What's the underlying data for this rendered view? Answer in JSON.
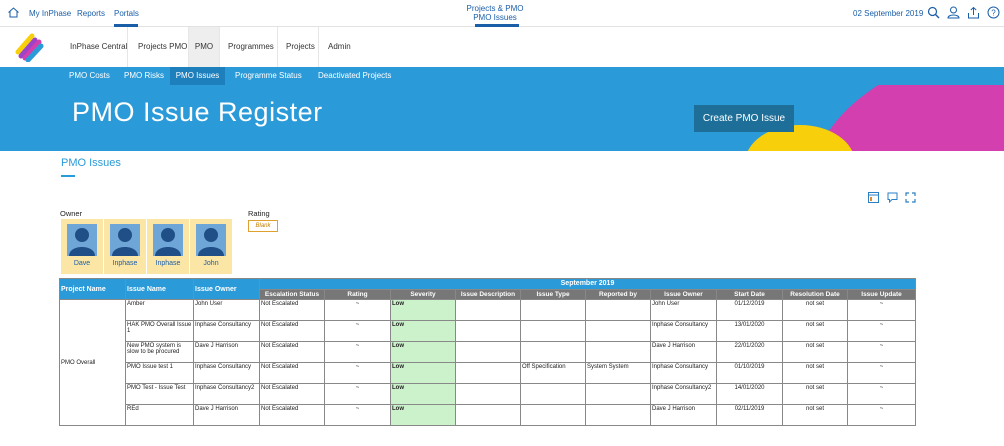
{
  "topbar": {
    "links": [
      "My InPhase",
      "Reports",
      "Portals"
    ],
    "center_line1": "Projects & PMO",
    "center_line2": "PMO Issues",
    "date": "02 September 2019",
    "icons": [
      "home-icon",
      "search-icon",
      "user-icon",
      "upload-icon",
      "help-icon"
    ]
  },
  "mainnav": {
    "items": [
      "InPhase Central",
      "Projects PMO",
      "PMO",
      "Programmes",
      "Projects",
      "Admin"
    ]
  },
  "subnav": {
    "tabs": [
      "PMO Costs",
      "PMO Risks",
      "PMO Issues",
      "Programme Status",
      "Deactivated Projects"
    ]
  },
  "banner": {
    "title": "PMO Issue Register",
    "create_button": "Create PMO Issue"
  },
  "section": {
    "title": "PMO Issues",
    "owner_label": "Owner",
    "rating_label": "Rating",
    "rating_value": "Blank"
  },
  "owners": [
    "Dave",
    "Inphase",
    "Inphase",
    "John"
  ],
  "toolbar_icons": [
    "report-icon",
    "comment-icon",
    "expand-icon"
  ],
  "table": {
    "headers": [
      "Project Name",
      "Issue Name",
      "Issue Owner"
    ],
    "month": "September 2019",
    "subheaders": [
      "Escalation Status",
      "Rating",
      "Severity",
      "Issue Description",
      "Issue Type",
      "Reported by",
      "Issue Owner",
      "Start Date",
      "Resolution Date",
      "Issue Update"
    ],
    "project": "PMO Overall",
    "rows": [
      {
        "issue": "Amber",
        "owner": "John User",
        "escalation": "Not Escalated",
        "rating": "~",
        "severity": "Low",
        "description": "",
        "type": "",
        "reported": "",
        "issue_owner": "John User",
        "start": "01/12/2019",
        "resolution": "not set",
        "update": "~"
      },
      {
        "issue": "HAK PMO Overall Issue 1",
        "owner": "Inphase Consultancy",
        "escalation": "Not Escalated",
        "rating": "~",
        "severity": "Low",
        "description": "",
        "type": "",
        "reported": "",
        "issue_owner": "Inphase Consultancy",
        "start": "13/01/2020",
        "resolution": "not set",
        "update": "~"
      },
      {
        "issue": "New PMO system is slow to be procured",
        "owner": "Dave J Harrison",
        "escalation": "Not Escalated",
        "rating": "~",
        "severity": "Low",
        "description": "",
        "type": "",
        "reported": "",
        "issue_owner": "Dave J Harrison",
        "start": "22/01/2020",
        "resolution": "not set",
        "update": "~"
      },
      {
        "issue": "PMO Issue test 1",
        "owner": "Inphase Consultancy",
        "escalation": "Not Escalated",
        "rating": "~",
        "severity": "Low",
        "description": "",
        "type": "Off Specification",
        "reported": "System System",
        "issue_owner": "Inphase Consultancy",
        "start": "01/10/2019",
        "resolution": "not set",
        "update": "~"
      },
      {
        "issue": "PMO Test - Issue Test",
        "owner": "Inphase Consultancy2",
        "escalation": "Not Escalated",
        "rating": "~",
        "severity": "Low",
        "description": "",
        "type": "",
        "reported": "",
        "issue_owner": "Inphase Consultancy2",
        "start": "14/01/2020",
        "resolution": "not set",
        "update": "~"
      },
      {
        "issue": "REd",
        "owner": "Dave J Harrison",
        "escalation": "Not Escalated",
        "rating": "~",
        "severity": "Low",
        "description": "",
        "type": "",
        "reported": "",
        "issue_owner": "Dave J Harrison",
        "start": "02/11/2019",
        "resolution": "not set",
        "update": "~"
      }
    ]
  },
  "colors": {
    "accent": "#2b9ad8",
    "dark_button": "#1d6e99",
    "owner_card": "#fce6a6",
    "severity_low": "#ccf2cc",
    "banner_magenta": "#d43fb0",
    "banner_yellow": "#f7cf0a"
  }
}
